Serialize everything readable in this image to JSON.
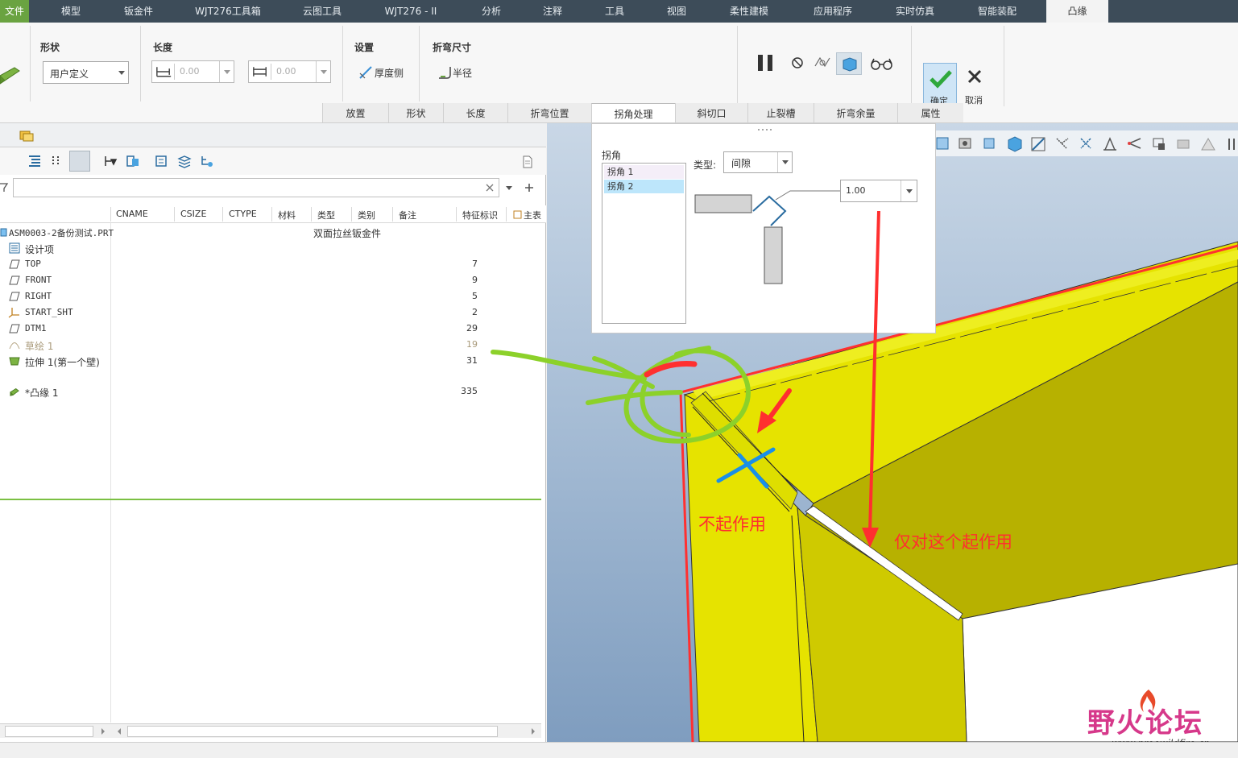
{
  "menubar": {
    "items": [
      "文件",
      "模型",
      "钣金件",
      "WJT276工具箱",
      "云图工具",
      "WJT276 - II",
      "分析",
      "注释",
      "工具",
      "视图",
      "柔性建模",
      "应用程序",
      "实时仿真",
      "智能装配",
      "凸缘"
    ]
  },
  "ribbon": {
    "groups": {
      "shape": "形状",
      "length": "长度",
      "settings": "设置",
      "bend_dim": "折弯尺寸"
    },
    "shape_select": "用户定义",
    "length1": "0.00",
    "length2": "0.00",
    "thickness_side": "厚度侧",
    "radius": "半径",
    "ok": "确定",
    "cancel": "取消",
    "tabs": [
      "放置",
      "形状",
      "长度",
      "折弯位置",
      "拐角处理",
      "斜切口",
      "止裂槽",
      "折弯余量",
      "属性"
    ]
  },
  "tree": {
    "columns": [
      "CNAME",
      "CSIZE",
      "CTYPE",
      "材料",
      "类型",
      "类别",
      "备注",
      "特征标识",
      "主表"
    ],
    "rows": [
      {
        "name": "ASM0003-2备份测试.PRT",
        "note": "双面拉丝钣金件",
        "id": ""
      },
      {
        "name": "设计项",
        "id": ""
      },
      {
        "name": "TOP",
        "id": "7"
      },
      {
        "name": "FRONT",
        "id": "9"
      },
      {
        "name": "RIGHT",
        "id": "5"
      },
      {
        "name": "START_SHT",
        "id": "2"
      },
      {
        "name": "DTM1",
        "id": "29"
      },
      {
        "name": "草绘 1",
        "id": "19"
      },
      {
        "name": "拉伸 1(第一个壁)",
        "id": "31"
      },
      {
        "name": "*凸缘 1",
        "id": "335"
      }
    ]
  },
  "dialog": {
    "corner_label": "拐角",
    "items": [
      "拐角 1",
      "拐角 2"
    ],
    "type_label": "类型:",
    "type_value": "间隙",
    "gap_value": "1.00"
  },
  "annotations": {
    "no_effect": "不起作用",
    "only_this": "仅对这个起作用"
  },
  "watermark": {
    "title": "野火论坛",
    "url": "www.proewildfire.cn"
  },
  "colors": {
    "menubar": "#3d4c59",
    "file_tab": "#6aa341",
    "part_yellow": "#e4e000",
    "edge_red": "#ff3030",
    "note_red": "#ff2f2f",
    "green_scribble": "#8cd12a",
    "blue_mark": "#1a8fe8"
  }
}
